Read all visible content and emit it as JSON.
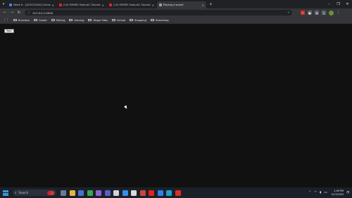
{
  "tabs": [
    {
      "label": "Week 6 - [XCS422SAS] Interacti",
      "fav": "#4285f4",
      "active": false
    },
    {
      "label": "(10) MM365 Module2 Tutorial1",
      "fav": "#e8212d",
      "active": false
    },
    {
      "label": "(10) MM365 Module2 Tutorial2",
      "fav": "#e8212d",
      "active": false
    },
    {
      "label": "Playing a sound",
      "fav": "#9aa0a6",
      "active": true
    }
  ],
  "tab_close_glyph": "×",
  "new_tab_glyph": "+",
  "window_controls": {
    "minimize": "–",
    "restore": "❐",
    "close": "✕"
  },
  "toolbar": {
    "url": "127.0.0.1:5500",
    "back_glyph": "←",
    "forward_glyph": "→",
    "reload_glyph": "↻",
    "info_glyph": "ⓘ",
    "star_glyph": "☆",
    "kebab_glyph": "⋮"
  },
  "extensions": [
    {
      "name": "red-extension-icon",
      "color": "#d93025",
      "glyph": "•"
    },
    {
      "name": "chat-extension-icon",
      "color": "#5f6368",
      "glyph": "●"
    },
    {
      "name": "puzzle-extension-icon",
      "color": "#5f6368",
      "glyph": "◈"
    },
    {
      "name": "sidepanel-icon",
      "color": "#5f6368",
      "glyph": "▯"
    }
  ],
  "bookmarks": {
    "apps_glyph": "⋮⋮",
    "items": [
      "Business",
      "Career",
      "Editing",
      "Gaming",
      "Illegal Sites",
      "School",
      "Shopping",
      "Streaming"
    ]
  },
  "page": {
    "start_button": "Start"
  },
  "taskbar": {
    "search_label": "Search",
    "search_glyph": "⌕",
    "apps": [
      {
        "name": "widgets-icon",
        "color": "#6b7a8f"
      },
      {
        "name": "file-explorer-icon",
        "color": "#e6b43c"
      },
      {
        "name": "media-icon",
        "color": "#4a6fd1"
      },
      {
        "name": "chrome-icon",
        "color": "#34a853"
      },
      {
        "name": "copilot-icon",
        "color": "#8a63d2"
      },
      {
        "name": "teams-icon",
        "color": "#5b5fc7"
      },
      {
        "name": "pen-icon",
        "color": "#cfd3da"
      },
      {
        "name": "chat-icon",
        "color": "#3a8ee6"
      },
      {
        "name": "photos-icon",
        "color": "#d9d9d9"
      },
      {
        "name": "files-icon",
        "color": "#c9483a"
      },
      {
        "name": "acrobat-icon",
        "color": "#e1251b"
      },
      {
        "name": "vscode-icon",
        "color": "#2f80ed"
      },
      {
        "name": "browser-icon",
        "color": "#1aa1c9"
      },
      {
        "name": "recorder-icon",
        "color": "#d93025"
      }
    ],
    "tray": {
      "chevron": "⌃",
      "wifi": "◠",
      "volume": "◖",
      "battery": "▭",
      "time": "1:09 PM",
      "date": "3/17/2025",
      "bell": "◔"
    }
  },
  "colors": {
    "accent": "#3a96dd",
    "page_bg": "#111111",
    "chrome_bg": "#35363a"
  }
}
